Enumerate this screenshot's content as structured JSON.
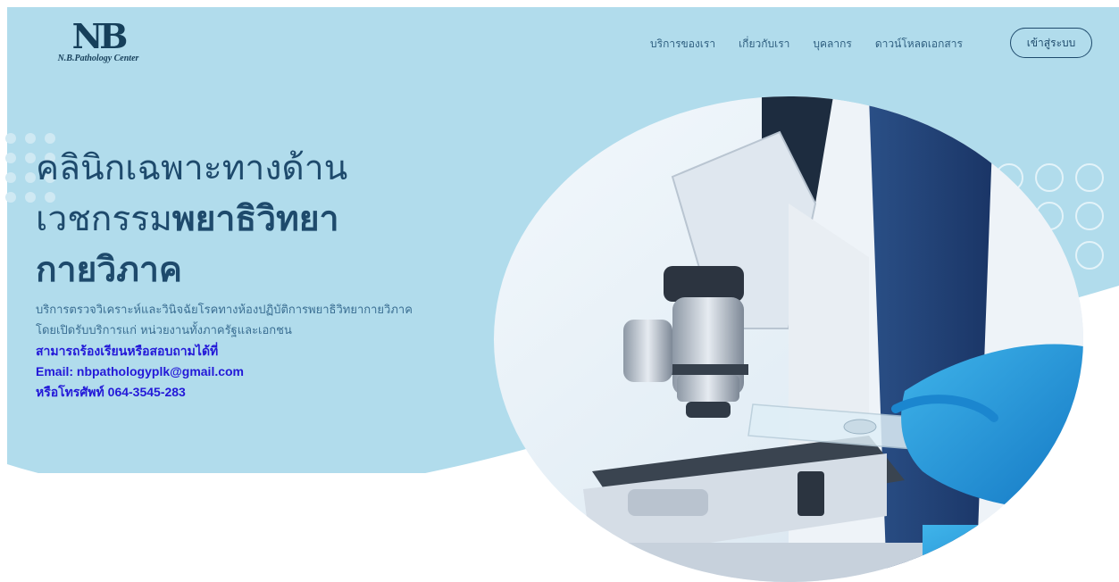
{
  "colors": {
    "hero_bg": "#b1dcec",
    "heading": "#1e4a6c",
    "body_text": "#3b6f93",
    "contact_text": "#2318d8",
    "glove": "#1f9ad9"
  },
  "logo": {
    "mark": "NB",
    "name": "N.B.Pathology Center"
  },
  "nav": {
    "items": [
      "บริการของเรา",
      "เกี่ยวกับเรา",
      "บุคลากร",
      "ดาวน์โหลดเอกสาร"
    ],
    "login_label": "เข้าสู่ระบบ"
  },
  "hero": {
    "line1": "คลินิกเฉพาะทางด้าน",
    "line2_regular": "เวชกรรม",
    "line2_bold": "พยาธิวิทยา",
    "line3": "กายวิภาค",
    "desc_line1": "บริการตรวจวิเคราะห์และวินิจฉัยโรคทางห้องปฏิบัติการพยาธิวิทยากายวิภาค",
    "desc_line2": "โดยเปิดรับบริการแก่ หน่วยงานทั้งภาครัฐและเอกชน",
    "contact_heading": "สามารถร้องเรียนหรือสอบถามได้ที่",
    "email": "Email: nbpathologyplk@gmail.com",
    "phone": "หรือโทรศัพท์ 064-3545-283",
    "photo_icon": "microscope-photo"
  }
}
